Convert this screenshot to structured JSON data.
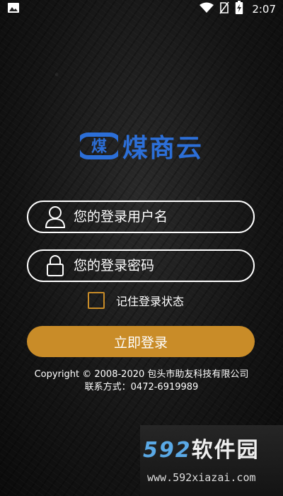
{
  "status_bar": {
    "time": "2:07",
    "icons": [
      "image-icon",
      "wifi-icon",
      "no-sim-icon",
      "battery-charging-icon"
    ]
  },
  "logo": {
    "mark_text": "煤",
    "text": "煤商云",
    "color": "#2c6fd8"
  },
  "form": {
    "username_placeholder": "您的登录用户名",
    "password_placeholder": "您的登录密码",
    "username_value": "",
    "password_value": "",
    "remember_label": "记住登录状态",
    "remember_checked": false,
    "login_label": "立即登录",
    "accent_color": "#c98c28"
  },
  "footer": {
    "copyright": "Copyright © 2008-2020 包头市助友科技有限公司",
    "contact": "联系方式：0472-6919989"
  },
  "watermark": {
    "brand_digits": "592",
    "brand_cn": "软件园",
    "url": "www.592xiazai.com"
  }
}
